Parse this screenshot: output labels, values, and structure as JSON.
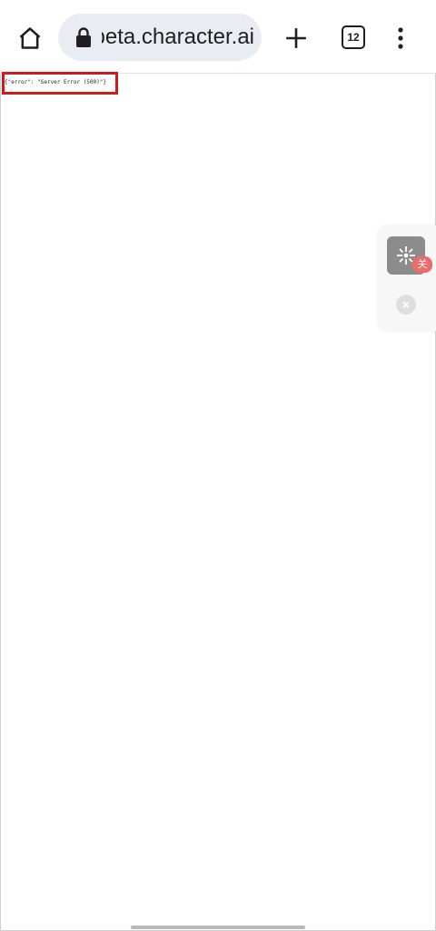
{
  "browser": {
    "url": "beta.character.ai",
    "tab_count": "12",
    "icons": {
      "home": "home-icon",
      "lock": "lock-icon",
      "new_tab": "plus-icon",
      "tabs": "tab-switcher-icon",
      "menu": "more-vert-icon"
    }
  },
  "page": {
    "raw_response": "{\"error\": \"Server Error (500)\"}"
  },
  "floating_widget": {
    "badge": "关",
    "icons": {
      "action": "sparkle-icon",
      "close": "close-circle-icon"
    }
  },
  "colors": {
    "highlight": "#d0191f",
    "omnibox": "#e9edf3"
  }
}
